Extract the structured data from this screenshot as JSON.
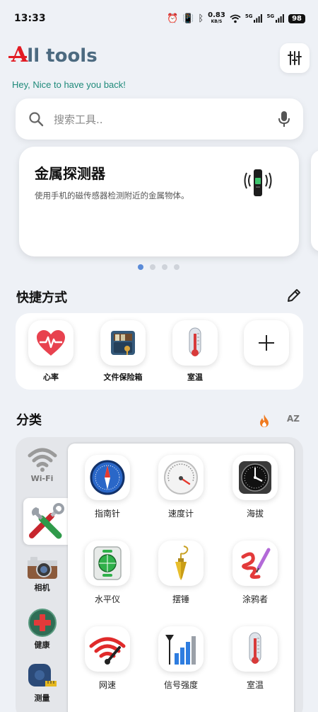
{
  "status": {
    "time": "13:33",
    "net_speed_value": "0.83",
    "net_speed_unit": "KB/S",
    "sig1": "5G",
    "sig2": "5G",
    "battery": "98"
  },
  "header": {
    "title_rest": "ll tools",
    "title_logo": "A",
    "subtitle": "Hey, Nice to have you back!",
    "settings_icon": "sliders-icon"
  },
  "search": {
    "placeholder": "搜索工具..",
    "icon": "search-icon",
    "voice_icon": "microphone-icon"
  },
  "carousel": {
    "title": "金属探测器",
    "description": "使用手机的磁传感器检测附近的金属物体。",
    "page_count": 4,
    "active_index": 0
  },
  "shortcuts": {
    "title": "快捷方式",
    "items": [
      {
        "label": "心率",
        "icon": "heart-rate-icon"
      },
      {
        "label": "文件保险箱",
        "icon": "file-vault-icon"
      },
      {
        "label": "室温",
        "icon": "thermometer-icon"
      }
    ],
    "add_icon": "plus-icon"
  },
  "categories": {
    "title": "分类",
    "sort_hot_icon": "fire-icon",
    "sort_az": "AZ",
    "side": [
      {
        "label": "Wi-Fi",
        "icon": "wifi-icon"
      },
      {
        "label": "",
        "icon": "tools-icon"
      },
      {
        "label": "相机",
        "icon": "camera-icon"
      },
      {
        "label": "健康",
        "icon": "health-icon"
      },
      {
        "label": "测量",
        "icon": "tape-measure-icon"
      }
    ],
    "tools": [
      {
        "label": "指南针",
        "icon": "compass-icon"
      },
      {
        "label": "速度计",
        "icon": "speedometer-icon"
      },
      {
        "label": "海拔",
        "icon": "altimeter-icon"
      },
      {
        "label": "水平仪",
        "icon": "level-icon"
      },
      {
        "label": "摆锤",
        "icon": "plumb-bob-icon"
      },
      {
        "label": "涂鸦者",
        "icon": "doodle-icon"
      },
      {
        "label": "网速",
        "icon": "net-speed-icon"
      },
      {
        "label": "信号强度",
        "icon": "signal-strength-icon"
      },
      {
        "label": "室温",
        "icon": "thermometer-icon"
      }
    ]
  },
  "colors": {
    "accent_red": "#e21b23",
    "title_blue": "#4c6a80",
    "subtitle_teal": "#1f8a7a",
    "dot_active": "#5b8bd8",
    "fire": "#f07a1f"
  }
}
